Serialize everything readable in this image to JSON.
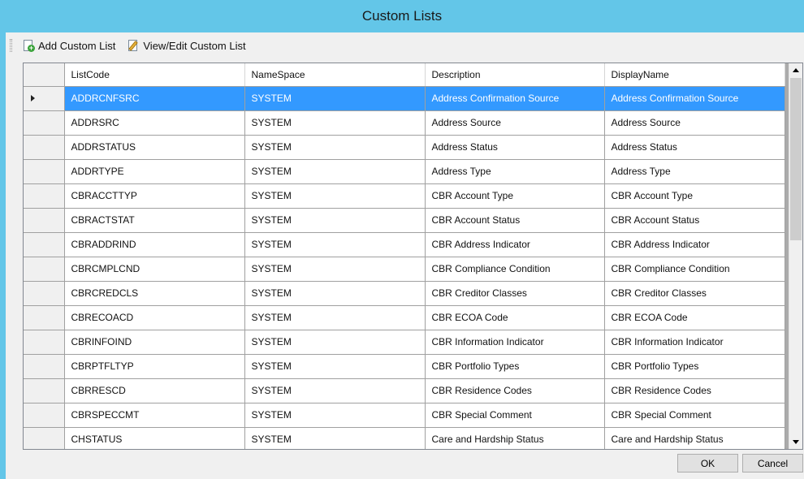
{
  "window": {
    "title": "Custom Lists"
  },
  "toolbar": {
    "add_label": "Add Custom List",
    "edit_label": "View/Edit Custom List",
    "add_icon": "add-document-icon",
    "edit_icon": "edit-document-icon"
  },
  "grid": {
    "columns": [
      "ListCode",
      "NameSpace",
      "Description",
      "DisplayName"
    ],
    "selected_row": 0,
    "rows": [
      [
        "ADDRCNFSRC",
        "SYSTEM",
        "Address Confirmation Source",
        "Address Confirmation Source"
      ],
      [
        "ADDRSRC",
        "SYSTEM",
        "Address Source",
        "Address Source"
      ],
      [
        "ADDRSTATUS",
        "SYSTEM",
        "Address Status",
        "Address Status"
      ],
      [
        "ADDRTYPE",
        "SYSTEM",
        "Address Type",
        "Address Type"
      ],
      [
        "CBRACCTTYP",
        "SYSTEM",
        "CBR Account Type",
        "CBR Account Type"
      ],
      [
        "CBRACTSTAT",
        "SYSTEM",
        "CBR Account Status",
        "CBR Account Status"
      ],
      [
        "CBRADDRIND",
        "SYSTEM",
        "CBR Address Indicator",
        "CBR Address Indicator"
      ],
      [
        "CBRCMPLCND",
        "SYSTEM",
        "CBR Compliance Condition",
        "CBR Compliance Condition"
      ],
      [
        "CBRCREDCLS",
        "SYSTEM",
        "CBR Creditor Classes",
        "CBR Creditor Classes"
      ],
      [
        "CBRECOACD",
        "SYSTEM",
        "CBR ECOA Code",
        "CBR ECOA Code"
      ],
      [
        "CBRINFOIND",
        "SYSTEM",
        "CBR Information Indicator",
        "CBR Information Indicator"
      ],
      [
        "CBRPTFLTYP",
        "SYSTEM",
        "CBR Portfolio Types",
        "CBR Portfolio Types"
      ],
      [
        "CBRRESCD",
        "SYSTEM",
        "CBR Residence Codes",
        "CBR Residence Codes"
      ],
      [
        "CBRSPECCMT",
        "SYSTEM",
        "CBR Special Comment",
        "CBR Special Comment"
      ],
      [
        "CHSTATUS",
        "SYSTEM",
        "Care and Hardship Status",
        "Care and Hardship Status"
      ]
    ]
  },
  "buttons": {
    "ok": "OK",
    "cancel": "Cancel"
  },
  "colors": {
    "titlebar": "#63c6e8",
    "selection": "#3399ff"
  }
}
